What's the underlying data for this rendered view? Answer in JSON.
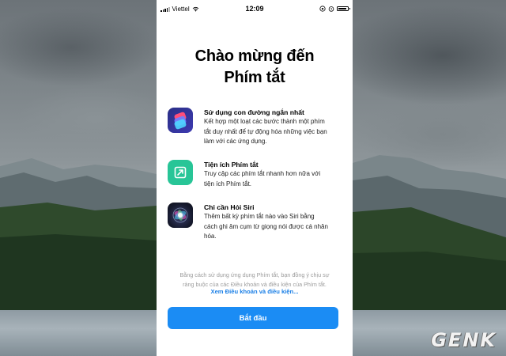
{
  "status_bar": {
    "carrier": "Viettel",
    "time": "12:09",
    "battery_level": 0.9,
    "signal_bars": 3
  },
  "welcome": {
    "title_line1": "Chào mừng đến",
    "title_line2": "Phím tắt"
  },
  "features": [
    {
      "icon": "shortcuts-app-icon",
      "title": "Sử dụng con đường ngắn nhất",
      "desc_lines": [
        "Kết hợp một loạt các bước thành một phím",
        "tắt duy nhất để tự động hóa những việc bạn",
        "làm với các ứng dụng."
      ]
    },
    {
      "icon": "widget-arrow-icon",
      "title": "Tiện ích Phím tắt",
      "desc_lines": [
        "Truy cập các phím tắt nhanh hơn nữa với",
        "tiện ích Phím tắt."
      ]
    },
    {
      "icon": "siri-icon",
      "title": "Chỉ cần Hỏi Siri",
      "desc_lines": [
        "Thêm bất kỳ phím tắt nào vào Siri bằng",
        "cách ghi âm cụm từ giọng nói được cá nhân",
        "hóa."
      ]
    }
  ],
  "legal": {
    "line1": "Bằng cách sử dụng ứng dụng Phím tắt, bạn đồng ý chịu sự",
    "line2": "ràng buộc của các Điều khoản và điều kiện của Phím tắt.",
    "link": "Xem Điều khoản và điều kiện..."
  },
  "cta": {
    "label": "Bắt đầu"
  },
  "watermark": "GENK",
  "colors": {
    "accent": "#1b8cf4",
    "link": "#1a7fe6",
    "widget_icon": "#28c597",
    "shortcuts_icon": "#2f3399"
  }
}
